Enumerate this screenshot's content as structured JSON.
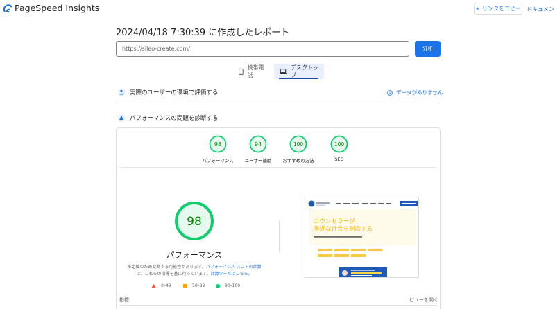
{
  "app": {
    "name": "PageSpeed Insights"
  },
  "header": {
    "copy_link_label": "リンクをコピー",
    "docs_label": "ドキュメント"
  },
  "report": {
    "title": "2024/04/18 7:30:39 に作成したレポート"
  },
  "search": {
    "url": "https://sileo-create.com/",
    "analyze_label": "分析"
  },
  "tabs": {
    "mobile_label": "携帯電話",
    "desktop_label": "デスクトップ",
    "selected": "desktop"
  },
  "field_data": {
    "heading": "実際のユーザーの環境で評価する",
    "status": "データがありません"
  },
  "lab_data": {
    "heading": "パフォーマンスの問題を診断する"
  },
  "categories": [
    {
      "score": "98",
      "label": "パフォーマンス"
    },
    {
      "score": "94",
      "label": "ユーザー補助"
    },
    {
      "score": "100",
      "label": "おすすめの方法"
    },
    {
      "score": "100",
      "label": "SEO"
    }
  ],
  "performance": {
    "score": "98",
    "title": "パフォーマンス",
    "desc_part1": "推定値のため変動する可能性があります。",
    "desc_link1": "パフォーマンス スコアの計算",
    "desc_part2": "は、これらの指標を基に行っています。",
    "desc_link2": "計算ツールはこちら。",
    "legend": [
      {
        "range": "0–49",
        "shape": "triangle",
        "color": "#ff4e42"
      },
      {
        "range": "50–89",
        "shape": "square",
        "color": "#ffa400"
      },
      {
        "range": "90–100",
        "shape": "circle",
        "color": "#0cce6b"
      }
    ]
  },
  "metrics": {
    "label": "指標",
    "view_toggle": "ビューを開く"
  },
  "page_preview": {
    "headline_1": "カウンセラーが",
    "headline_2": "身近な社会を創造する"
  },
  "colors": {
    "accent": "#1a73e8",
    "pass": "#0cce6b",
    "pass_dark": "#008800"
  }
}
